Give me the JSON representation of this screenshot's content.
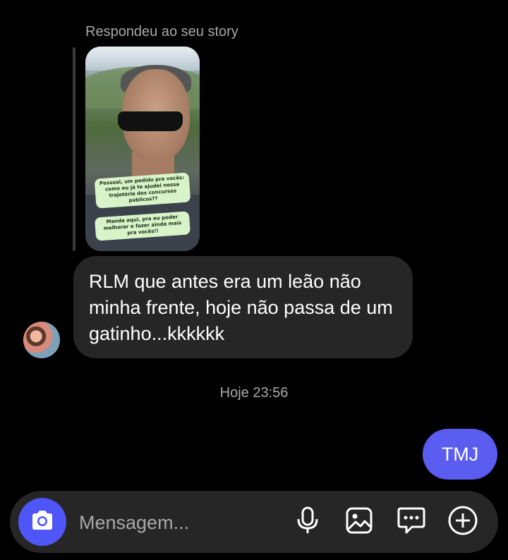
{
  "thread": {
    "reply_context": "Respondeu ao seu story",
    "story_sticker_1": "Pessoal, um pedido pra vocês: como eu já te ajudei nessa trajetória dos concursos públicos??",
    "story_sticker_2": "Manda aqui, pra eu poder melhorar e fazer ainda mais pra vocês!!",
    "received_message": "RLM que antes era um leão não minha frente, hoje não passa de um gatinho...kkkkkk",
    "timestamp": "Hoje 23:56",
    "sent_message": "TMJ"
  },
  "composer": {
    "placeholder": "Mensagem...",
    "icons": [
      "camera-icon",
      "microphone-icon",
      "gallery-icon",
      "sticker-chat-icon",
      "plus-icon"
    ]
  },
  "colors": {
    "background": "#000000",
    "received_bubble": "#262626",
    "sent_bubble": "#5b5cf0",
    "accent": "#4f56f7",
    "muted_text": "#a8a8a8"
  }
}
